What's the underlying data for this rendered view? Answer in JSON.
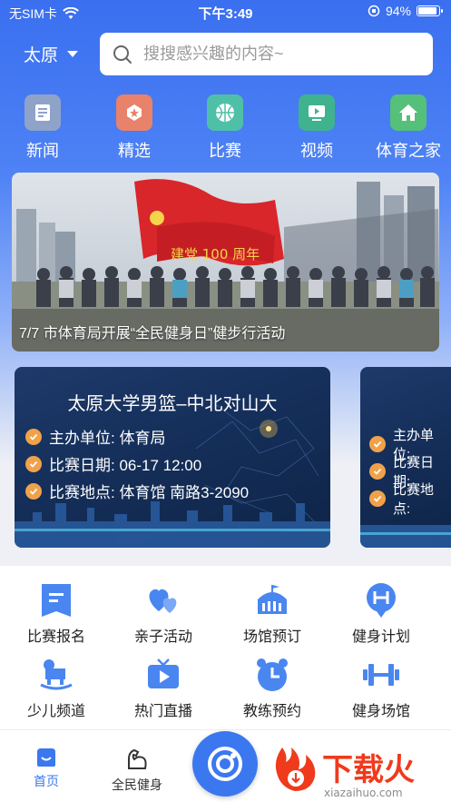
{
  "status_bar": {
    "carrier": "无SIM卡",
    "time": "下午3:49",
    "battery_percent": "94%",
    "battery_level": 0.94
  },
  "header": {
    "city": "太原",
    "search_placeholder": "搜搜感兴趣的内容~"
  },
  "categories": [
    {
      "label": "新闻",
      "icon": "news-icon",
      "color": "#8fa3c9"
    },
    {
      "label": "精选",
      "icon": "featured-icon",
      "color": "#e8826a"
    },
    {
      "label": "比赛",
      "icon": "basketball-icon",
      "color": "#4fc0a8"
    },
    {
      "label": "视频",
      "icon": "video-icon",
      "color": "#3fb28e"
    },
    {
      "label": "体育之家",
      "icon": "home-icon",
      "color": "#55c07a"
    }
  ],
  "banner": {
    "caption": "7/7 市体育局开展“全民健身日”健步行活动",
    "sign_text": "建党 100 周年"
  },
  "match_card": {
    "title": "太原大学男篮–中北对山大",
    "organizer": "主办单位: 体育局",
    "date": "比赛日期: 06-17 12:00",
    "venue": "比赛地点: 体育馆 南路3-2090"
  },
  "match_card_peek": {
    "organizer": "主办单位:",
    "date": "比赛日期:",
    "venue": "比赛地点:"
  },
  "services": [
    {
      "label": "比赛报名",
      "icon": "registration-icon"
    },
    {
      "label": "亲子活动",
      "icon": "hearts-icon"
    },
    {
      "label": "场馆预订",
      "icon": "stadium-icon"
    },
    {
      "label": "健身计划",
      "icon": "plan-icon"
    },
    {
      "label": "少儿频道",
      "icon": "rocking-horse-icon"
    },
    {
      "label": "热门直播",
      "icon": "live-icon"
    },
    {
      "label": "教练预约",
      "icon": "clock-icon"
    },
    {
      "label": "健身场馆",
      "icon": "dumbbell-icon"
    }
  ],
  "tabbar": {
    "home": "首页",
    "fitness": "全民健身"
  },
  "watermark": {
    "brand": "下载火",
    "domain": "xiazaihuo.com"
  },
  "colors": {
    "primary": "#3b78f0",
    "icon_blue": "#4a86f0",
    "check_orange": "#f0a24a"
  }
}
